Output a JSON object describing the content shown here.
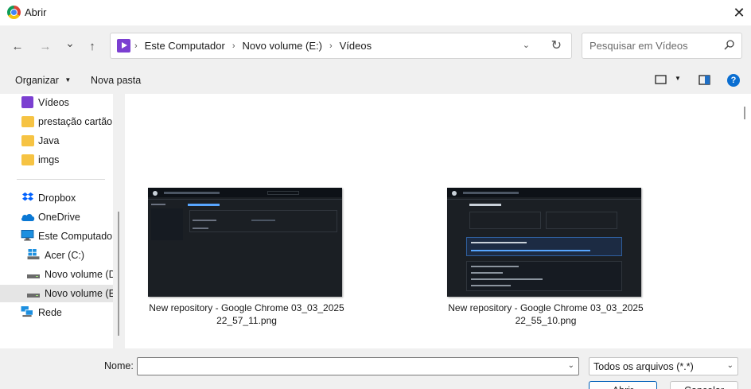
{
  "window": {
    "title": "Abrir",
    "close_glyph": "✕"
  },
  "navigation": {
    "back_glyph": "←",
    "forward_glyph": "→",
    "recent_glyph": "⌄",
    "up_glyph": "↑",
    "breadcrumbs": [
      "Este Computador",
      "Novo volume (E:)",
      "Vídeos"
    ],
    "breadcrumb_separator": "›",
    "refresh_glyph": "↻",
    "search_placeholder": "Pesquisar em Vídeos"
  },
  "toolbar": {
    "organize_label": "Organizar",
    "new_folder_label": "Nova pasta",
    "help_glyph": "?"
  },
  "sidebar": {
    "items": [
      {
        "label": "Vídeos",
        "icon": "videos-icon"
      },
      {
        "label": "prestação cartão (",
        "icon": "folder-icon"
      },
      {
        "label": "Java",
        "icon": "folder-icon"
      },
      {
        "label": "imgs",
        "icon": "folder-icon"
      },
      {
        "label": "Dropbox",
        "icon": "dropbox-icon"
      },
      {
        "label": "OneDrive",
        "icon": "onedrive-icon"
      },
      {
        "label": "Este Computador",
        "icon": "computer-icon"
      },
      {
        "label": "Acer (C:)",
        "icon": "windows-drive-icon"
      },
      {
        "label": "Novo volume (D",
        "icon": "drive-icon"
      },
      {
        "label": "Novo volume (E",
        "icon": "drive-icon"
      },
      {
        "label": "Rede",
        "icon": "network-icon"
      }
    ]
  },
  "files": [
    {
      "line1": "New repository - Google Chrome 03_03_2025",
      "line2": "22_57_11.png"
    },
    {
      "line1": "New repository - Google Chrome 03_03_2025",
      "line2": "22_55_10.png"
    }
  ],
  "footer": {
    "name_label": "Nome:",
    "name_value": "",
    "file_type": "Todos os arquivos (*.*)",
    "open_label": "Abrir",
    "cancel_label": "Cancelar",
    "dropdown_glyph": "⌄"
  },
  "colors": {
    "accent": "#005fb8",
    "selected_bg": "#e5e5e5",
    "folder": "#f6c343",
    "help": "#0a6ed1"
  }
}
